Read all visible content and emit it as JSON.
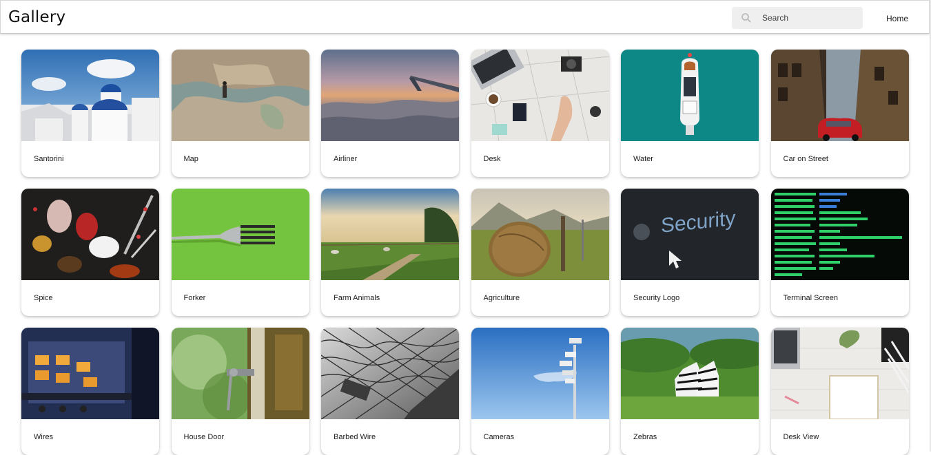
{
  "header": {
    "title": "Gallery",
    "nav_home": "Home"
  },
  "search": {
    "placeholder": "Search"
  },
  "cards": [
    {
      "label": "Santorini"
    },
    {
      "label": "Map"
    },
    {
      "label": "Airliner"
    },
    {
      "label": "Desk"
    },
    {
      "label": "Water"
    },
    {
      "label": "Car on Street"
    },
    {
      "label": "Spice"
    },
    {
      "label": "Forker"
    },
    {
      "label": "Farm Animals"
    },
    {
      "label": "Agriculture"
    },
    {
      "label": "Security Logo"
    },
    {
      "label": "Terminal Screen"
    },
    {
      "label": "Wires"
    },
    {
      "label": "House Door"
    },
    {
      "label": "Barbed Wire"
    },
    {
      "label": "Cameras"
    },
    {
      "label": "Zebras"
    },
    {
      "label": "Desk View"
    }
  ],
  "thumbnail_text": {
    "security": "Security"
  }
}
